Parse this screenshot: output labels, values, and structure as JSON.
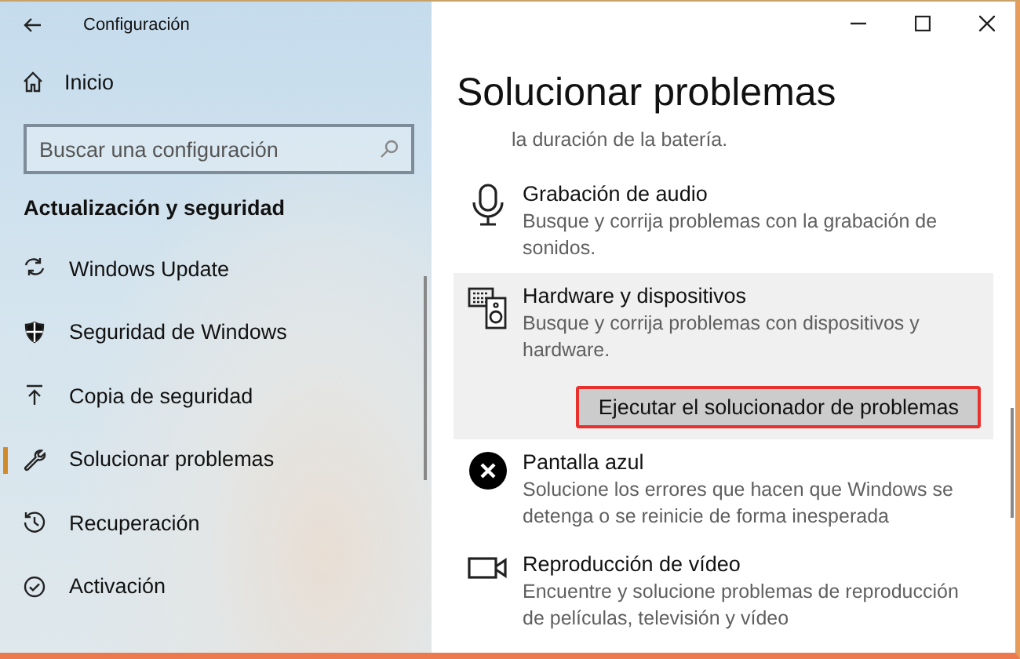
{
  "window": {
    "title": "Configuración"
  },
  "sidebar": {
    "home": "Inicio",
    "search": {
      "placeholder": "Buscar una configuración"
    },
    "section": "Actualización y seguridad",
    "items": [
      {
        "label": "Windows Update",
        "selected": false
      },
      {
        "label": "Seguridad de Windows",
        "selected": false
      },
      {
        "label": "Copia de seguridad",
        "selected": false
      },
      {
        "label": "Solucionar problemas",
        "selected": true
      },
      {
        "label": "Recuperación",
        "selected": false
      },
      {
        "label": "Activación",
        "selected": false
      }
    ]
  },
  "page": {
    "heading": "Solucionar problemas",
    "cut_text": "la duración de la batería.",
    "troubleshooters": [
      {
        "title": "Grabación de audio",
        "description": "Busque y corrija problemas con la grabación de sonidos.",
        "expanded": false
      },
      {
        "title": "Hardware y dispositivos",
        "description": "Busque y corrija problemas con dispositivos y hardware.",
        "expanded": true,
        "button": "Ejecutar el solucionador de problemas"
      },
      {
        "title": "Pantalla azul",
        "description": "Solucione los errores que hacen que Windows se detenga o se reinicie de forma inesperada",
        "expanded": false
      },
      {
        "title": "Reproducción de vídeo",
        "description": "Encuentre y solucione problemas de reproducción de películas, televisión y vídeo",
        "expanded": false
      }
    ]
  }
}
